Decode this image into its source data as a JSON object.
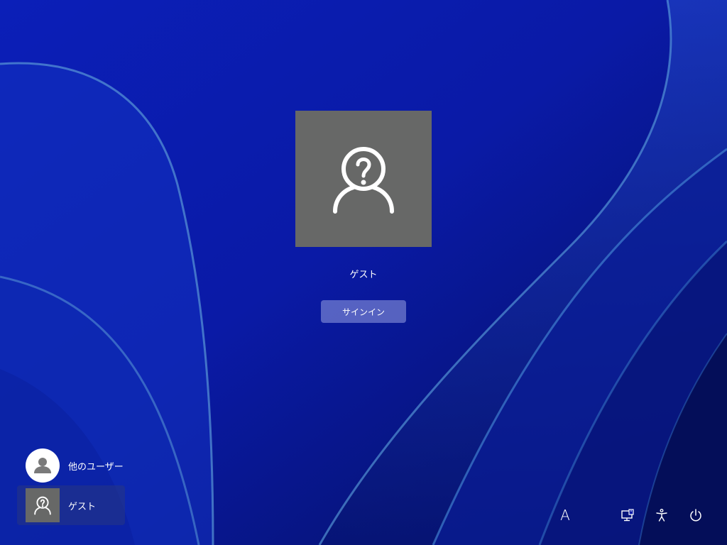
{
  "lock_screen": {
    "selected_user": {
      "name": "ゲスト",
      "avatar_icon": "guest-user-icon",
      "signin_label": "サインイン"
    },
    "user_list": [
      {
        "name": "他のユーザー",
        "icon": "generic-user-icon",
        "selected": false
      },
      {
        "name": "ゲスト",
        "icon": "guest-user-icon",
        "selected": true
      }
    ],
    "tray": {
      "ime_label": "A",
      "icons": [
        "network-icon",
        "accessibility-icon",
        "power-icon"
      ]
    }
  },
  "colors": {
    "wallpaper_base": "#0a1aa8",
    "avatar_bg": "#676867",
    "button_bg": "#8a95d8",
    "text": "#ffffff"
  }
}
